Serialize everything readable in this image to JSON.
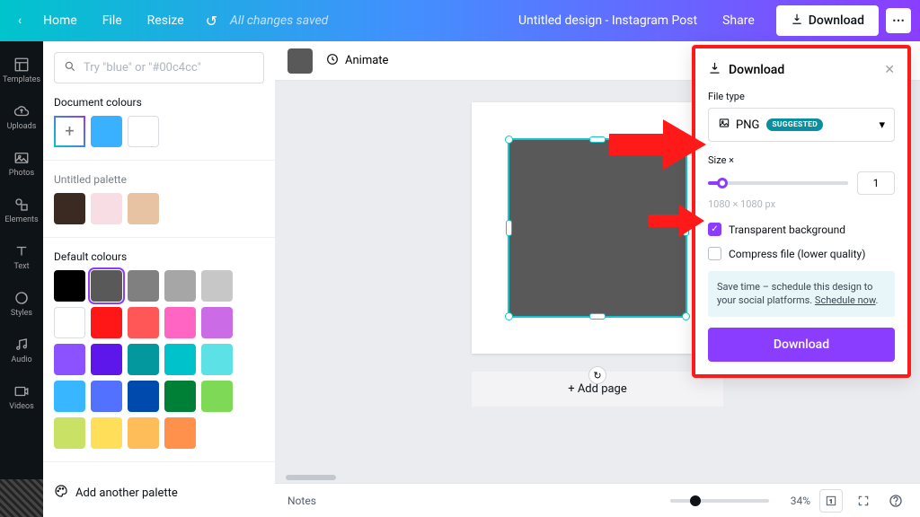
{
  "topbar": {
    "home": "Home",
    "file": "File",
    "resize": "Resize",
    "saved": "All changes saved",
    "doc_title": "Untitled design - Instagram Post",
    "share": "Share",
    "download": "Download"
  },
  "nav": {
    "templates": "Templates",
    "uploads": "Uploads",
    "photos": "Photos",
    "elements": "Elements",
    "text": "Text",
    "styles": "Styles",
    "audio": "Audio",
    "videos": "Videos"
  },
  "palette": {
    "search_placeholder": "Try \"blue\" or \"#00c4cc\"",
    "doc_colours_label": "Document colours",
    "untitled_label": "Untitled palette",
    "default_label": "Default colours",
    "add_palette": "Add another palette",
    "doc_colours": [
      "#3ab1ff",
      "#ffffff"
    ],
    "untitled": [
      "#3b2a22",
      "#f9dde4",
      "#e7c3a4"
    ],
    "default": [
      "#000000",
      "#595959",
      "#808080",
      "#a6a6a6",
      "#c7c7c7",
      "#ffffff",
      "#ff1616",
      "#ff5757",
      "#ff66c4",
      "#cb6ce6",
      "#8c52ff",
      "#5e17eb",
      "#03989e",
      "#00c2cb",
      "#5ce1e6",
      "#38b6ff",
      "#5271ff",
      "#004aad",
      "#008037",
      "#7ed957",
      "#c9e265",
      "#ffde59",
      "#ffbd59",
      "#ff914d"
    ]
  },
  "toolbar": {
    "animate": "Animate"
  },
  "stage": {
    "add_page": "+ Add page"
  },
  "bottom": {
    "notes": "Notes",
    "zoom": "34%"
  },
  "dl": {
    "title": "Download",
    "file_type_label": "File type",
    "file_type": "PNG",
    "badge": "SUGGESTED",
    "size_label": "Size ×",
    "size_value": "1",
    "dims": "1080 × 1080 px",
    "transparent": "Transparent background",
    "compress": "Compress file (lower quality)",
    "tip_a": "Save time – schedule this design to your social platforms. ",
    "tip_b": "Schedule now",
    "cta": "Download"
  }
}
